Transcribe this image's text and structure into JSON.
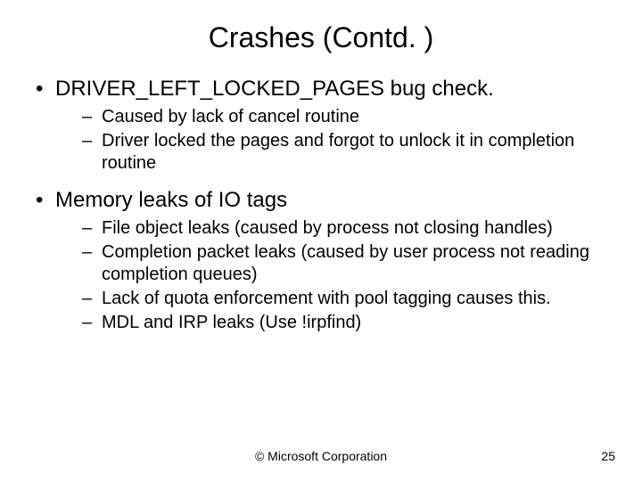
{
  "title": "Crashes (Contd. )",
  "bullets": [
    {
      "text": "DRIVER_LEFT_LOCKED_PAGES bug check.",
      "sub": [
        "Caused by lack of cancel routine",
        "Driver locked the pages and forgot to unlock it in completion routine"
      ]
    },
    {
      "text": "Memory leaks of IO tags",
      "sub": [
        "File object leaks (caused by process not closing handles)",
        "Completion packet leaks (caused by user process not reading completion queues)",
        "Lack of quota enforcement with pool tagging causes this.",
        "MDL and IRP leaks (Use !irpfind)"
      ]
    }
  ],
  "footer": {
    "copyright": "© Microsoft Corporation",
    "page": "25"
  }
}
